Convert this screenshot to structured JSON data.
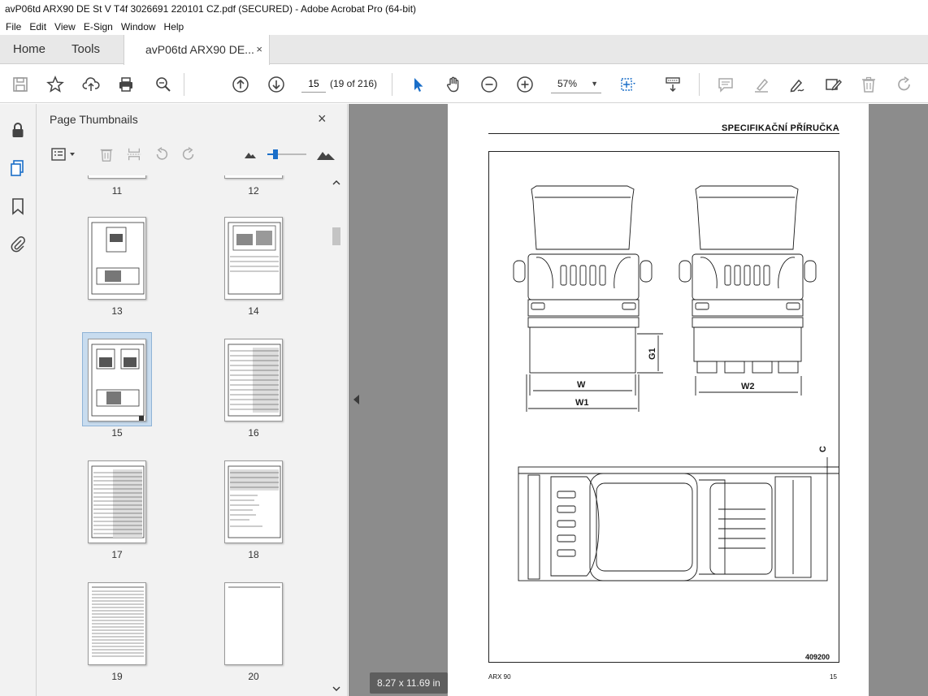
{
  "window": {
    "title": "avP06td ARX90 DE St V T4f 3026691 220101 CZ.pdf (SECURED) - Adobe Acrobat Pro (64-bit)"
  },
  "menu": [
    "File",
    "Edit",
    "View",
    "E-Sign",
    "Window",
    "Help"
  ],
  "tabs": {
    "home": "Home",
    "tools": "Tools",
    "document": "avP06td ARX90 DE...",
    "close": "×"
  },
  "toolbar": {
    "page_current": "15",
    "page_of": "(19 of 216)",
    "zoom": "57%",
    "icons": [
      "save-icon",
      "bookmark-star-icon",
      "upload-icon",
      "print-icon",
      "search-zoom-icon",
      "prev-page-icon",
      "next-page-icon",
      "select-arrow-icon",
      "hand-icon",
      "zoom-out-icon",
      "zoom-in-icon",
      "marquee-zoom-icon",
      "scroll-mode-icon",
      "comment-icon",
      "highlight-icon",
      "sign-icon",
      "fill-form-icon",
      "delete-icon",
      "redo-icon"
    ]
  },
  "left_rail": [
    "lock-icon",
    "pages-icon",
    "bookmark-icon",
    "attachment-icon"
  ],
  "panel": {
    "title": "Page Thumbnails",
    "close": "×",
    "thumbnails": [
      "11",
      "12",
      "13",
      "14",
      "15",
      "16",
      "17",
      "18",
      "19",
      "20"
    ],
    "selected": "15"
  },
  "document_page": {
    "header": "SPECIFIKAČNÍ PŘÍRUČKA",
    "labels": {
      "w": "W",
      "w1": "W1",
      "w2": "W2",
      "g1": "G1",
      "c": "C"
    },
    "figure_id": "409200",
    "model": "ARX 90",
    "page_number": "15"
  },
  "status": {
    "page_size": "8.27 x 11.69 in"
  },
  "colors": {
    "accent": "#1a6ec8",
    "tab_bg": "#e8e8e8",
    "viewer_bg": "#8c8c8c",
    "panel_bg": "#f2f2f2"
  }
}
